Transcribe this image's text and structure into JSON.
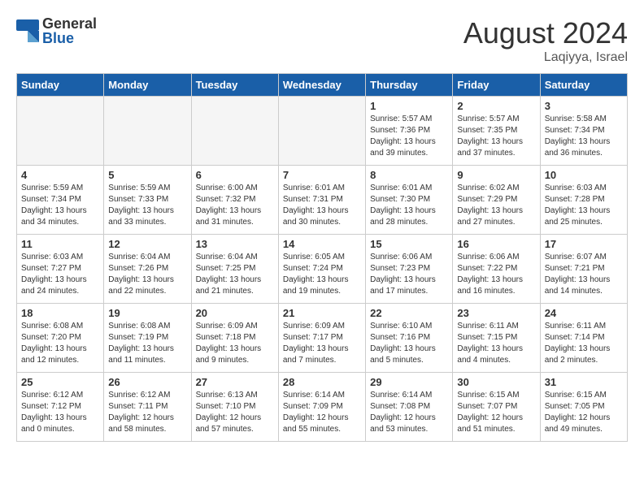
{
  "header": {
    "logo_general": "General",
    "logo_blue": "Blue",
    "month_year": "August 2024",
    "location": "Laqiyya, Israel"
  },
  "days_of_week": [
    "Sunday",
    "Monday",
    "Tuesday",
    "Wednesday",
    "Thursday",
    "Friday",
    "Saturday"
  ],
  "weeks": [
    [
      {
        "day": "",
        "empty": true
      },
      {
        "day": "",
        "empty": true
      },
      {
        "day": "",
        "empty": true
      },
      {
        "day": "",
        "empty": true
      },
      {
        "day": "1",
        "sunrise": "5:57 AM",
        "sunset": "7:36 PM",
        "daylight": "13 hours and 39 minutes."
      },
      {
        "day": "2",
        "sunrise": "5:57 AM",
        "sunset": "7:35 PM",
        "daylight": "13 hours and 37 minutes."
      },
      {
        "day": "3",
        "sunrise": "5:58 AM",
        "sunset": "7:34 PM",
        "daylight": "13 hours and 36 minutes."
      }
    ],
    [
      {
        "day": "4",
        "sunrise": "5:59 AM",
        "sunset": "7:34 PM",
        "daylight": "13 hours and 34 minutes."
      },
      {
        "day": "5",
        "sunrise": "5:59 AM",
        "sunset": "7:33 PM",
        "daylight": "13 hours and 33 minutes."
      },
      {
        "day": "6",
        "sunrise": "6:00 AM",
        "sunset": "7:32 PM",
        "daylight": "13 hours and 31 minutes."
      },
      {
        "day": "7",
        "sunrise": "6:01 AM",
        "sunset": "7:31 PM",
        "daylight": "13 hours and 30 minutes."
      },
      {
        "day": "8",
        "sunrise": "6:01 AM",
        "sunset": "7:30 PM",
        "daylight": "13 hours and 28 minutes."
      },
      {
        "day": "9",
        "sunrise": "6:02 AM",
        "sunset": "7:29 PM",
        "daylight": "13 hours and 27 minutes."
      },
      {
        "day": "10",
        "sunrise": "6:03 AM",
        "sunset": "7:28 PM",
        "daylight": "13 hours and 25 minutes."
      }
    ],
    [
      {
        "day": "11",
        "sunrise": "6:03 AM",
        "sunset": "7:27 PM",
        "daylight": "13 hours and 24 minutes."
      },
      {
        "day": "12",
        "sunrise": "6:04 AM",
        "sunset": "7:26 PM",
        "daylight": "13 hours and 22 minutes."
      },
      {
        "day": "13",
        "sunrise": "6:04 AM",
        "sunset": "7:25 PM",
        "daylight": "13 hours and 21 minutes."
      },
      {
        "day": "14",
        "sunrise": "6:05 AM",
        "sunset": "7:24 PM",
        "daylight": "13 hours and 19 minutes."
      },
      {
        "day": "15",
        "sunrise": "6:06 AM",
        "sunset": "7:23 PM",
        "daylight": "13 hours and 17 minutes."
      },
      {
        "day": "16",
        "sunrise": "6:06 AM",
        "sunset": "7:22 PM",
        "daylight": "13 hours and 16 minutes."
      },
      {
        "day": "17",
        "sunrise": "6:07 AM",
        "sunset": "7:21 PM",
        "daylight": "13 hours and 14 minutes."
      }
    ],
    [
      {
        "day": "18",
        "sunrise": "6:08 AM",
        "sunset": "7:20 PM",
        "daylight": "13 hours and 12 minutes."
      },
      {
        "day": "19",
        "sunrise": "6:08 AM",
        "sunset": "7:19 PM",
        "daylight": "13 hours and 11 minutes."
      },
      {
        "day": "20",
        "sunrise": "6:09 AM",
        "sunset": "7:18 PM",
        "daylight": "13 hours and 9 minutes."
      },
      {
        "day": "21",
        "sunrise": "6:09 AM",
        "sunset": "7:17 PM",
        "daylight": "13 hours and 7 minutes."
      },
      {
        "day": "22",
        "sunrise": "6:10 AM",
        "sunset": "7:16 PM",
        "daylight": "13 hours and 5 minutes."
      },
      {
        "day": "23",
        "sunrise": "6:11 AM",
        "sunset": "7:15 PM",
        "daylight": "13 hours and 4 minutes."
      },
      {
        "day": "24",
        "sunrise": "6:11 AM",
        "sunset": "7:14 PM",
        "daylight": "13 hours and 2 minutes."
      }
    ],
    [
      {
        "day": "25",
        "sunrise": "6:12 AM",
        "sunset": "7:12 PM",
        "daylight": "13 hours and 0 minutes."
      },
      {
        "day": "26",
        "sunrise": "6:12 AM",
        "sunset": "7:11 PM",
        "daylight": "12 hours and 58 minutes."
      },
      {
        "day": "27",
        "sunrise": "6:13 AM",
        "sunset": "7:10 PM",
        "daylight": "12 hours and 57 minutes."
      },
      {
        "day": "28",
        "sunrise": "6:14 AM",
        "sunset": "7:09 PM",
        "daylight": "12 hours and 55 minutes."
      },
      {
        "day": "29",
        "sunrise": "6:14 AM",
        "sunset": "7:08 PM",
        "daylight": "12 hours and 53 minutes."
      },
      {
        "day": "30",
        "sunrise": "6:15 AM",
        "sunset": "7:07 PM",
        "daylight": "12 hours and 51 minutes."
      },
      {
        "day": "31",
        "sunrise": "6:15 AM",
        "sunset": "7:05 PM",
        "daylight": "12 hours and 49 minutes."
      }
    ]
  ]
}
